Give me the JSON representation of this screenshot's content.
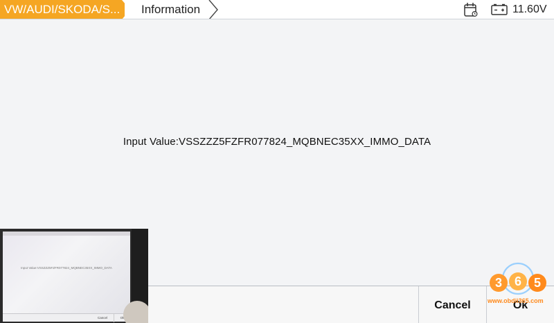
{
  "header": {
    "breadcrumb_primary": "VW/AUDI/SKODA/S...",
    "breadcrumb_secondary": "Information",
    "battery_voltage": "11.60V",
    "icons": [
      "calendar-icon",
      "battery-icon"
    ]
  },
  "main": {
    "message": "Input Value:VSSZZZ5FZFR077824_MQBNEC35XX_IMMO_DATA"
  },
  "footer": {
    "cancel_label": "Cancel",
    "ok_label": "Ok"
  },
  "colors": {
    "accent": "#f5a623",
    "background": "#f3f4f6",
    "watermark": "#ff8a1c"
  },
  "overlay": {
    "message": "Input Value:VSSZZZ5FZFR077824_MQBNEC35XX_IMMO_DATA",
    "cancel_label": "Cancel",
    "ok_label": "Ok"
  },
  "watermark": {
    "logo_text": "365",
    "url": "www.obdii365.com"
  }
}
